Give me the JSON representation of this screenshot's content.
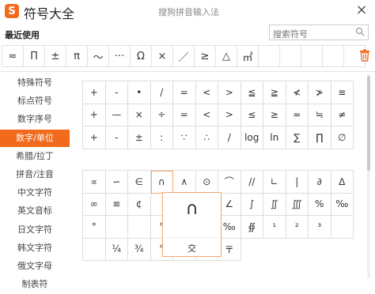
{
  "app": {
    "title": "符号大全",
    "logo": "S",
    "subtitle": "搜狗拼音输入法",
    "close": "×",
    "accent": "#f26b1d"
  },
  "recent": {
    "title": "最近使用",
    "symbols": [
      "≈",
      "Π",
      "±",
      "π",
      "～",
      "···",
      "Ω",
      "×",
      "／",
      "≥",
      "△",
      "㎡",
      "",
      "",
      "",
      "",
      ""
    ]
  },
  "search": {
    "placeholder": "搜索符号",
    "icon": "search-icon"
  },
  "sidebar": {
    "items": [
      {
        "label": "特殊符号"
      },
      {
        "label": "标点符号"
      },
      {
        "label": "数字序号"
      },
      {
        "label": "数字/单位",
        "active": true
      },
      {
        "label": "希腊/拉丁"
      },
      {
        "label": "拼音/注音"
      },
      {
        "label": "中文字符"
      },
      {
        "label": "英文音标"
      },
      {
        "label": "日文字符"
      },
      {
        "label": "韩文字符"
      },
      {
        "label": "俄文字母"
      },
      {
        "label": "制表符"
      }
    ]
  },
  "grid1": [
    [
      "+",
      "-",
      "•",
      "/",
      "=",
      "<",
      ">",
      "≦",
      "≧",
      "≮",
      "≯",
      "≡"
    ],
    [
      "+",
      "—",
      "×",
      "÷",
      "=",
      "<",
      ">",
      "≤",
      "≥",
      "≈",
      "≒",
      "≠"
    ],
    [
      "+",
      "-",
      "±",
      ":",
      "∵",
      "∴",
      "/",
      "log",
      "ln",
      "∑",
      "∏",
      "∅"
    ]
  ],
  "grid2": [
    [
      "∝",
      "∽",
      "∈",
      "∩",
      "∧",
      "⊙",
      "⌒",
      "//",
      "∟",
      "|",
      "∂",
      "∆"
    ],
    [
      "∞",
      "≌",
      "¢",
      "",
      "",
      "⊥",
      "∠",
      "∫",
      "∬",
      "∭"
    ],
    [
      "%",
      "‰",
      "°",
      "",
      "",
      "°",
      "℃",
      "℉",
      "‰",
      "∯"
    ],
    [
      "¹",
      "²",
      "³",
      "",
      "",
      "¼",
      "¾",
      "°",
      "℃",
      "℉",
      "〒"
    ]
  ],
  "popup": {
    "symbol": "∩",
    "name": "交"
  }
}
